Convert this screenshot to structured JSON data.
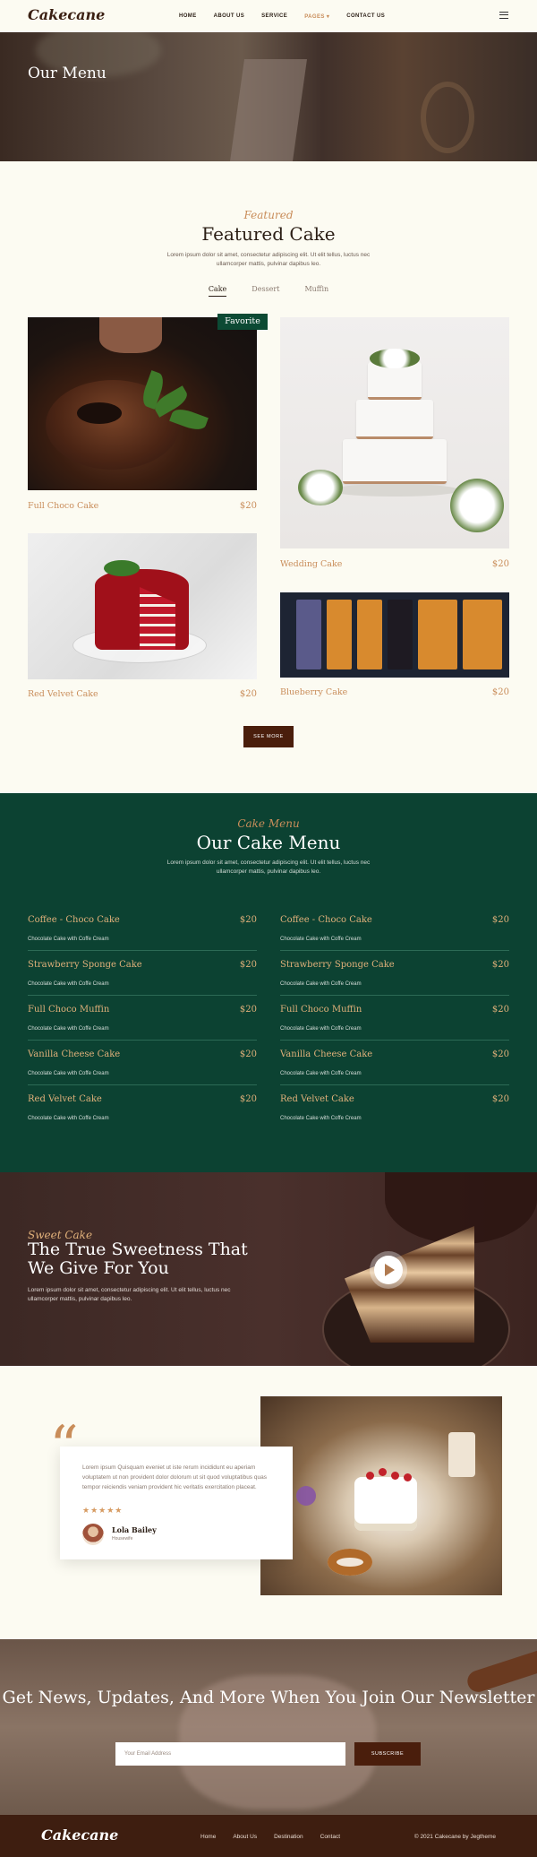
{
  "header": {
    "logo": "Cakecane",
    "nav": [
      "HOME",
      "ABOUT US",
      "SERVICE",
      "PAGES ▾",
      "CONTACT US"
    ]
  },
  "hero": {
    "title": "Our Menu"
  },
  "featured": {
    "subtitle": "Featured",
    "title": "Featured Cake",
    "description": "Lorem ipsum dolor sit amet, consectetur adipiscing elit. Ut elit tellus, luctus nec ullamcorper mattis, pulvinar dapibus leo.",
    "tabs": [
      "Cake",
      "Dessert",
      "Muffin"
    ],
    "badge": "Favorite",
    "items": [
      {
        "name": "Full Choco Cake",
        "price": "$20"
      },
      {
        "name": "Wedding Cake",
        "price": "$20"
      },
      {
        "name": "Red Velvet Cake",
        "price": "$20"
      },
      {
        "name": "Blueberry Cake",
        "price": "$20"
      }
    ],
    "see_more": "SEE MORE"
  },
  "cake_menu": {
    "subtitle": "Cake Menu",
    "title": "Our Cake Menu",
    "description": "Lorem ipsum dolor sit amet, consectetur adipiscing elit. Ut elit tellus, luctus nec ullamcorper mattis, pulvinar dapibus leo.",
    "left": [
      {
        "name": "Coffee - Choco Cake",
        "price": "$20",
        "desc": "Chocolate Cake with Coffe Cream"
      },
      {
        "name": "Strawberry Sponge Cake",
        "price": "$20",
        "desc": "Chocolate Cake with Coffe Cream"
      },
      {
        "name": "Full Choco Muffin",
        "price": "$20",
        "desc": "Chocolate Cake with Coffe Cream"
      },
      {
        "name": "Vanilla Cheese Cake",
        "price": "$20",
        "desc": "Chocolate Cake with Coffe Cream"
      },
      {
        "name": "Red Velvet Cake",
        "price": "$20",
        "desc": "Chocolate Cake with Coffe Cream"
      }
    ],
    "right": [
      {
        "name": "Coffee - Choco Cake",
        "price": "$20",
        "desc": "Chocolate Cake with Coffe Cream"
      },
      {
        "name": "Strawberry Sponge Cake",
        "price": "$20",
        "desc": "Chocolate Cake with Coffe Cream"
      },
      {
        "name": "Full Choco Muffin",
        "price": "$20",
        "desc": "Chocolate Cake with Coffe Cream"
      },
      {
        "name": "Vanilla Cheese Cake",
        "price": "$20",
        "desc": "Chocolate Cake with Coffe Cream"
      },
      {
        "name": "Red Velvet Cake",
        "price": "$20",
        "desc": "Chocolate Cake with Coffe Cream"
      }
    ]
  },
  "sweet": {
    "subtitle": "Sweet Cake",
    "title": "The True Sweetness That We Give For You",
    "description": "Lorem ipsum dolor sit amet, consectetur adipiscing elit. Ut elit tellus, luctus nec ullamcorper mattis, pulvinar dapibus leo."
  },
  "testimonial": {
    "text": "Lorem ipsum Quisquam eveniet ut iste rerum incididunt eu aperiam voluptatem ut non provident dolor dolorum ut sit quod voluptatibus quas tempor reiciendis veniam provident hic veritatis exercitation placeat.",
    "stars": "★★★★★",
    "name": "Lola Bailey",
    "role": "Housewife"
  },
  "newsletter": {
    "title": "Get News, Updates, And More When You Join Our Newsletter",
    "placeholder": "Your Email Address",
    "button": "SUBSCRIBE"
  },
  "footer": {
    "logo": "Cakecane",
    "nav": [
      "Home",
      "About Us",
      "Destination",
      "Contact"
    ],
    "copyright": "© 2021 Cakecane by Jegtheme"
  },
  "colors": {
    "accent": "#c98d5a",
    "dark_green": "#0c4232",
    "brown": "#4a1e0c"
  }
}
